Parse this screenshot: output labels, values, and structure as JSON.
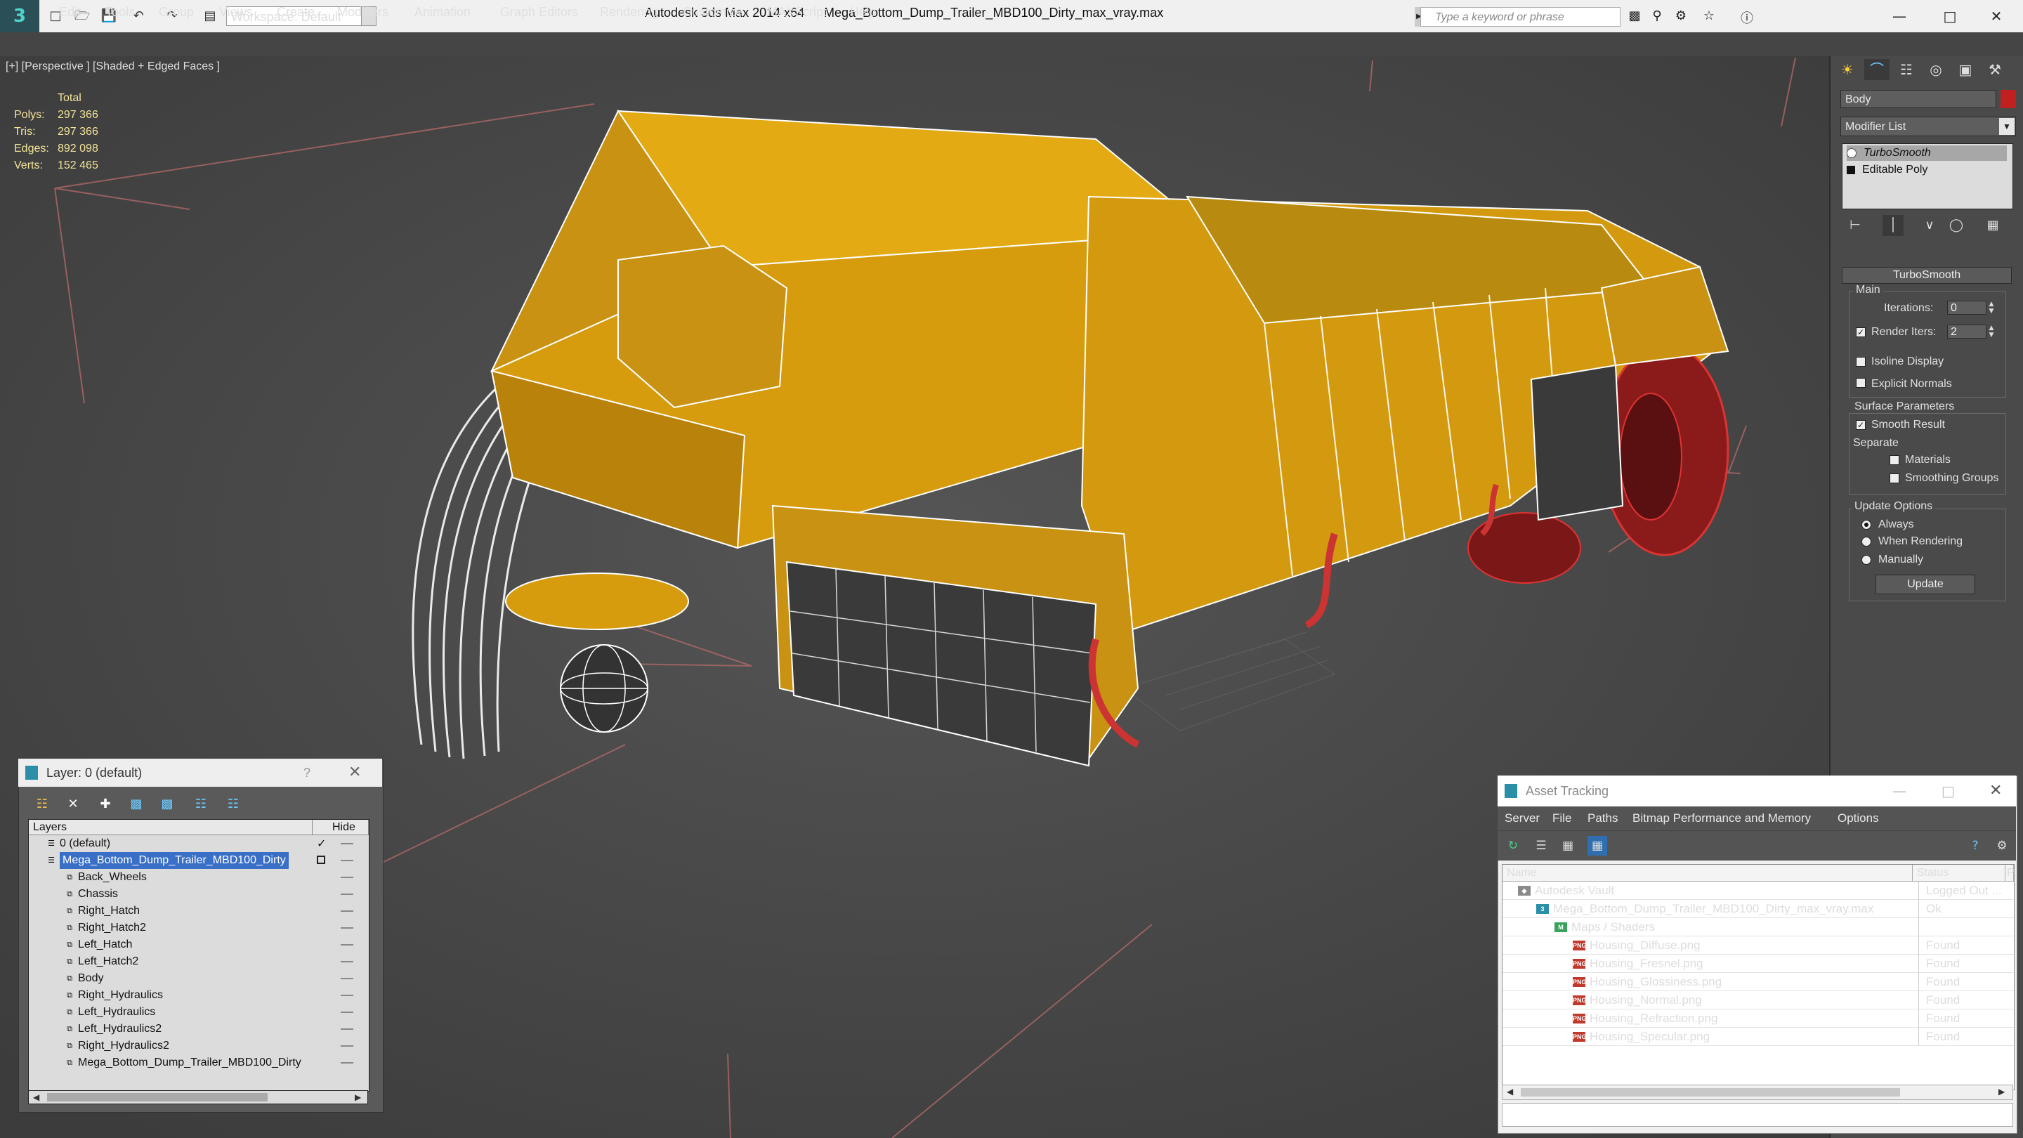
{
  "titlebar": {
    "workspace": "Workspace: Default",
    "app_title": "Autodesk 3ds Max  2014 x64",
    "file_title": "Mega_Bottom_Dump_Trailer_MBD100_Dirty_max_vray.max",
    "search_placeholder": "Type a keyword or phrase"
  },
  "menu": [
    "Edit",
    "Tools",
    "Group",
    "Views",
    "Create",
    "Modifiers",
    "Animation",
    "Graph Editors",
    "Rendering",
    "Customize",
    "MAXScript",
    "Help"
  ],
  "viewport": {
    "label": "[+] [Perspective ] [Shaded + Edged Faces ]",
    "stats_header": "Total",
    "stats": [
      {
        "label": "Polys:",
        "value": "297 366"
      },
      {
        "label": "Tris:",
        "value": "297 366"
      },
      {
        "label": "Edges:",
        "value": "892 098"
      },
      {
        "label": "Verts:",
        "value": "152 465"
      }
    ]
  },
  "command_panel": {
    "object_name": "Body",
    "object_color": "#c1201f",
    "modifier_list": "Modifier List",
    "stack": [
      "TurboSmooth",
      "Editable Poly"
    ],
    "rollout_title": "TurboSmooth",
    "main_group": "Main",
    "iterations_label": "Iterations:",
    "iterations_value": "0",
    "render_iters_label": "Render Iters:",
    "render_iters_value": "2",
    "isoline_display": "Isoline Display",
    "explicit_normals": "Explicit Normals",
    "surface_params": "Surface Parameters",
    "smooth_result": "Smooth Result",
    "separate": "Separate",
    "materials": "Materials",
    "smoothing_groups": "Smoothing Groups",
    "update_options": "Update Options",
    "always": "Always",
    "when_rendering": "When Rendering",
    "manually": "Manually",
    "update_button": "Update"
  },
  "layer_window": {
    "title": "Layer: 0 (default)",
    "help": "?",
    "col_layers": "Layers",
    "col_hide": "Hide",
    "rows": [
      {
        "name": "0 (default)",
        "level": 1,
        "kind": "layer"
      },
      {
        "name": "Mega_Bottom_Dump_Trailer_MBD100_Dirty",
        "level": 1,
        "kind": "layer",
        "selected": true
      },
      {
        "name": "Back_Wheels",
        "level": 2,
        "kind": "object"
      },
      {
        "name": "Chassis",
        "level": 2,
        "kind": "object"
      },
      {
        "name": "Right_Hatch",
        "level": 2,
        "kind": "object"
      },
      {
        "name": "Right_Hatch2",
        "level": 2,
        "kind": "object"
      },
      {
        "name": "Left_Hatch",
        "level": 2,
        "kind": "object"
      },
      {
        "name": "Left_Hatch2",
        "level": 2,
        "kind": "object"
      },
      {
        "name": "Body",
        "level": 2,
        "kind": "object"
      },
      {
        "name": "Right_Hydraulics",
        "level": 2,
        "kind": "object"
      },
      {
        "name": "Left_Hydraulics",
        "level": 2,
        "kind": "object"
      },
      {
        "name": "Left_Hydraulics2",
        "level": 2,
        "kind": "object"
      },
      {
        "name": "Right_Hydraulics2",
        "level": 2,
        "kind": "object"
      },
      {
        "name": "Mega_Bottom_Dump_Trailer_MBD100_Dirty",
        "level": 2,
        "kind": "object"
      }
    ]
  },
  "asset_tracking": {
    "title": "Asset Tracking",
    "menu": [
      "Server",
      "File",
      "Paths",
      "Bitmap Performance and Memory",
      "Options"
    ],
    "col_name": "Name",
    "col_status": "Status",
    "col_p": "P",
    "rows": [
      {
        "name": "Autodesk Vault",
        "status": "Logged Out ...",
        "level": 0,
        "icon": "vault"
      },
      {
        "name": "Mega_Bottom_Dump_Trailer_MBD100_Dirty_max_vray.max",
        "status": "Ok",
        "level": 1,
        "icon": "max"
      },
      {
        "name": "Maps / Shaders",
        "status": "",
        "level": 2,
        "icon": "maps"
      },
      {
        "name": "Housing_Diffuse.png",
        "status": "Found",
        "level": 3,
        "icon": "png"
      },
      {
        "name": "Housing_Fresnel.png",
        "status": "Found",
        "level": 3,
        "icon": "png"
      },
      {
        "name": "Housing_Glossiness.png",
        "status": "Found",
        "level": 3,
        "icon": "png"
      },
      {
        "name": "Housing_Normal.png",
        "status": "Found",
        "level": 3,
        "icon": "png"
      },
      {
        "name": "Housing_Refraction.png",
        "status": "Found",
        "level": 3,
        "icon": "png"
      },
      {
        "name": "Housing_Specular.png",
        "status": "Found",
        "level": 3,
        "icon": "png"
      }
    ]
  }
}
